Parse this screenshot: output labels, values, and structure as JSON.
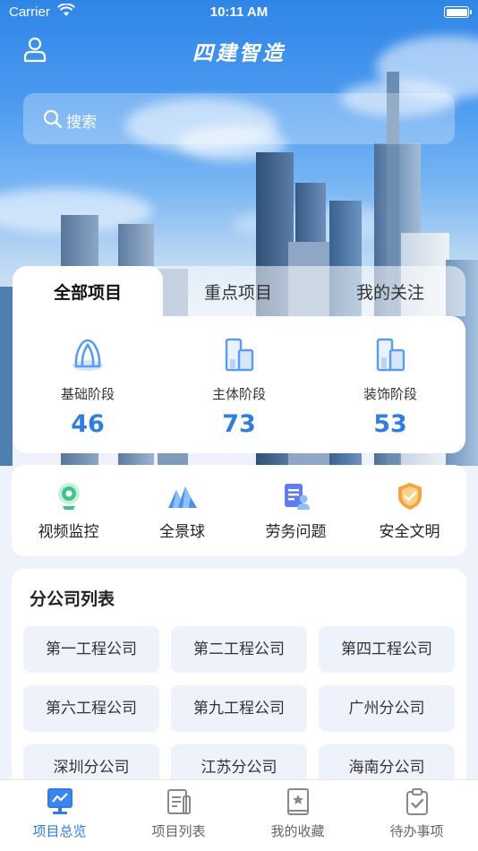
{
  "status_bar": {
    "carrier": "Carrier",
    "time": "10:11 AM"
  },
  "header": {
    "title": "四建智造"
  },
  "search": {
    "placeholder": "搜索"
  },
  "tabs": [
    {
      "label": "全部项目",
      "active": true
    },
    {
      "label": "重点项目",
      "active": false
    },
    {
      "label": "我的关注",
      "active": false
    }
  ],
  "stages": [
    {
      "label": "基础阶段",
      "count": "46",
      "icon": "foundation-icon"
    },
    {
      "label": "主体阶段",
      "count": "73",
      "icon": "building-icon"
    },
    {
      "label": "装饰阶段",
      "count": "53",
      "icon": "decoration-icon"
    }
  ],
  "actions": [
    {
      "label": "视频监控",
      "icon": "camera-icon"
    },
    {
      "label": "全景球",
      "icon": "panorama-icon"
    },
    {
      "label": "劳务问题",
      "icon": "labor-icon"
    },
    {
      "label": "安全文明",
      "icon": "safety-shield-icon"
    }
  ],
  "branch_list": {
    "title": "分公司列表",
    "items": [
      "第一工程公司",
      "第二工程公司",
      "第四工程公司",
      "第六工程公司",
      "第九工程公司",
      "广州分公司",
      "深圳分公司",
      "江苏分公司",
      "海南分公司"
    ]
  },
  "tabbar": [
    {
      "label": "项目总览",
      "active": true,
      "icon": "overview-icon"
    },
    {
      "label": "项目列表",
      "active": false,
      "icon": "list-icon"
    },
    {
      "label": "我的收藏",
      "active": false,
      "icon": "favorites-icon"
    },
    {
      "label": "待办事项",
      "active": false,
      "icon": "todo-icon"
    }
  ],
  "colors": {
    "accent": "#2f7de1",
    "icon_blue": "#5b9cf0"
  }
}
